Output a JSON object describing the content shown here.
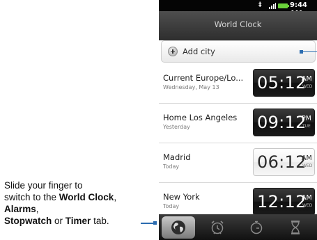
{
  "status_bar": {
    "usb": "‡",
    "time": "9:44 AM"
  },
  "title_bar": {
    "title": "World Clock"
  },
  "add_city": {
    "label": "Add city"
  },
  "clocks": [
    {
      "city": "Current  Europe/Lo...",
      "sub": "Wednesday, May 13",
      "time": "05:12",
      "ampm": "AM",
      "day": "WED",
      "style": "dark"
    },
    {
      "city": "Home  Los Angeles",
      "sub": "Yesterday",
      "time": "09:12",
      "ampm": "PM",
      "day": "TUE",
      "style": "dark"
    },
    {
      "city": "Madrid",
      "sub": "Today",
      "time": "06:12",
      "ampm": "AM",
      "day": "WED",
      "style": "light"
    },
    {
      "city": "New York",
      "sub": "Today",
      "time": "12:12",
      "ampm": "AM",
      "day": "WED",
      "style": "dark"
    }
  ],
  "tabs": [
    {
      "name": "world-clock",
      "icon": "globe-icon",
      "active": true
    },
    {
      "name": "alarms",
      "icon": "alarm-clock-icon",
      "active": false
    },
    {
      "name": "stopwatch",
      "icon": "stopwatch-icon",
      "active": false
    },
    {
      "name": "timer",
      "icon": "hourglass-icon",
      "active": false
    }
  ],
  "caption": {
    "line1": "Slide your finger to",
    "line2a": "switch to the ",
    "world_clock": "World Clock",
    "comma1": ", ",
    "alarms": "Alarms",
    "comma2": ",",
    "stopwatch": "Stopwatch",
    "or": " or ",
    "timer": "Timer",
    "tab_suffix": " tab."
  },
  "colors": {
    "callout": "#2b6cb0",
    "battery": "#6ad13a",
    "titlebar": "#3a3a3a"
  }
}
